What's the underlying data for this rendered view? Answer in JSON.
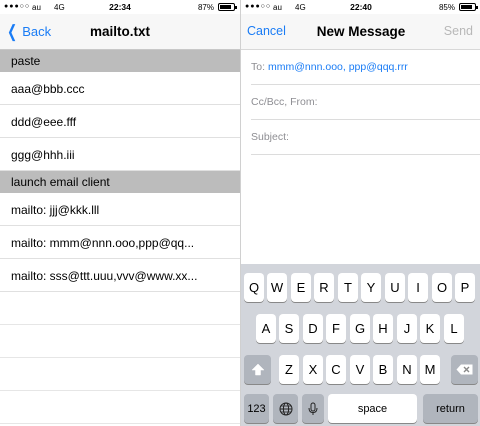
{
  "left": {
    "status": {
      "signal": "●●●○○",
      "carrier": "au",
      "network": "4G",
      "time": "22:34",
      "battery": "87%",
      "battery_level": 0.87
    },
    "nav": {
      "back_label": "Back",
      "title": "mailto.txt"
    },
    "sections": [
      {
        "header": "paste",
        "items": [
          "aaa@bbb.ccc",
          "ddd@eee.fff",
          "ggg@hhh.iii"
        ]
      },
      {
        "header": "launch email client",
        "items": [
          "mailto: jjj@kkk.lll",
          "mailto: mmm@nnn.ooo,ppp@qq...",
          "mailto: sss@ttt.uuu,vvv@www.xx..."
        ]
      }
    ]
  },
  "right": {
    "status": {
      "signal": "●●●○○",
      "carrier": "au",
      "network": "4G",
      "time": "22:40",
      "battery": "85%",
      "battery_level": 0.85
    },
    "nav": {
      "cancel_label": "Cancel",
      "title": "New Message",
      "send_label": "Send"
    },
    "fields": {
      "to_label": "To:",
      "to_value": "mmm@nnn.ooo, ppp@qqq.rrr",
      "ccbcc_label": "Cc/Bcc, From:",
      "subject_label": "Subject:"
    },
    "keyboard": {
      "row1": [
        "Q",
        "W",
        "E",
        "R",
        "T",
        "Y",
        "U",
        "I",
        "O",
        "P"
      ],
      "row2": [
        "A",
        "S",
        "D",
        "F",
        "G",
        "H",
        "J",
        "K",
        "L"
      ],
      "row3": [
        "Z",
        "X",
        "C",
        "V",
        "B",
        "N",
        "M"
      ],
      "numbers_label": "123",
      "space_label": "space",
      "return_label": "return"
    }
  }
}
